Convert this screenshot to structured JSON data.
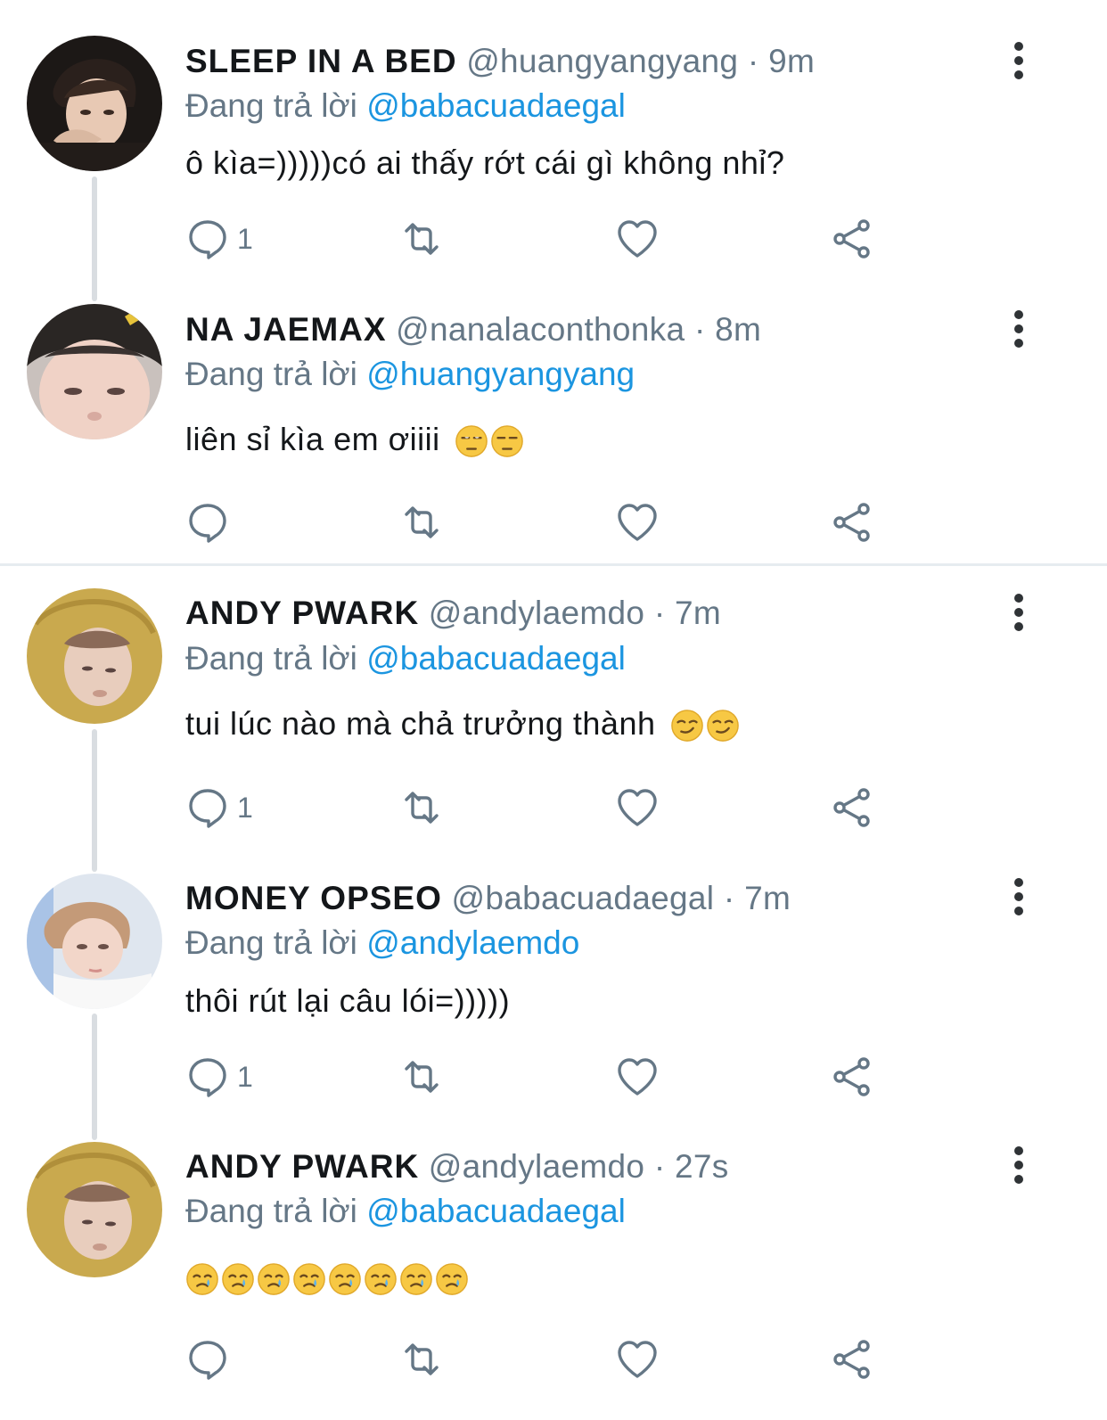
{
  "tweets": [
    {
      "name": "SLEEP IN A BED",
      "handle": "@huangyangyang",
      "dot": "·",
      "time": "9m",
      "reply_prefix": "Đang trả lời",
      "reply_to": "@babacuadaegal",
      "text": "ô kìa=)))))có ai thấy rớt cái gì không nhỉ?",
      "reply_count": "1",
      "avatar_icon": "avatar-photo-icon"
    },
    {
      "name": "NA JAEMAX",
      "handle": "@nanalaconthonka",
      "dot": "·",
      "time": "8m",
      "reply_prefix": "Đang trả lời",
      "reply_to": "@huangyangyang",
      "text": "liên sỉ kìa em ơiiii",
      "emoji": "😒😒",
      "reply_count": "",
      "avatar_icon": "avatar-photo-icon"
    },
    {
      "name": "ANDY PWARK",
      "handle": "@andylaemdo",
      "dot": "·",
      "time": "7m",
      "reply_prefix": "Đang trả lời",
      "reply_to": "@babacuadaegal",
      "text": "tui lúc nào mà chả trưởng thành",
      "emoji": "😏😏",
      "reply_count": "1",
      "avatar_icon": "avatar-photo-icon"
    },
    {
      "name": "MONEY OPSEO",
      "handle": "@babacuadaegal",
      "dot": "·",
      "time": "7m",
      "reply_prefix": "Đang trả lời",
      "reply_to": "@andylaemdo",
      "text": "thôi rút lại câu lói=)))))",
      "reply_count": "1",
      "avatar_icon": "avatar-photo-icon"
    },
    {
      "name": "ANDY PWARK",
      "handle": "@andylaemdo",
      "dot": "·",
      "time": "27s",
      "reply_prefix": "Đang trả lời",
      "reply_to": "@babacuadaegal",
      "text": "",
      "emoji": "🥲🥲🥲🥲🥲🥲🥲🥲",
      "reply_count": "",
      "avatar_icon": "avatar-photo-icon"
    }
  ],
  "icons": {
    "reply": "reply-icon",
    "retweet": "retweet-icon",
    "like": "heart-icon",
    "share": "share-icon",
    "more": "more-vertical-icon"
  },
  "colors": {
    "link": "#1b95e0",
    "secondary": "#657786",
    "thread_line": "#d9dde1"
  }
}
